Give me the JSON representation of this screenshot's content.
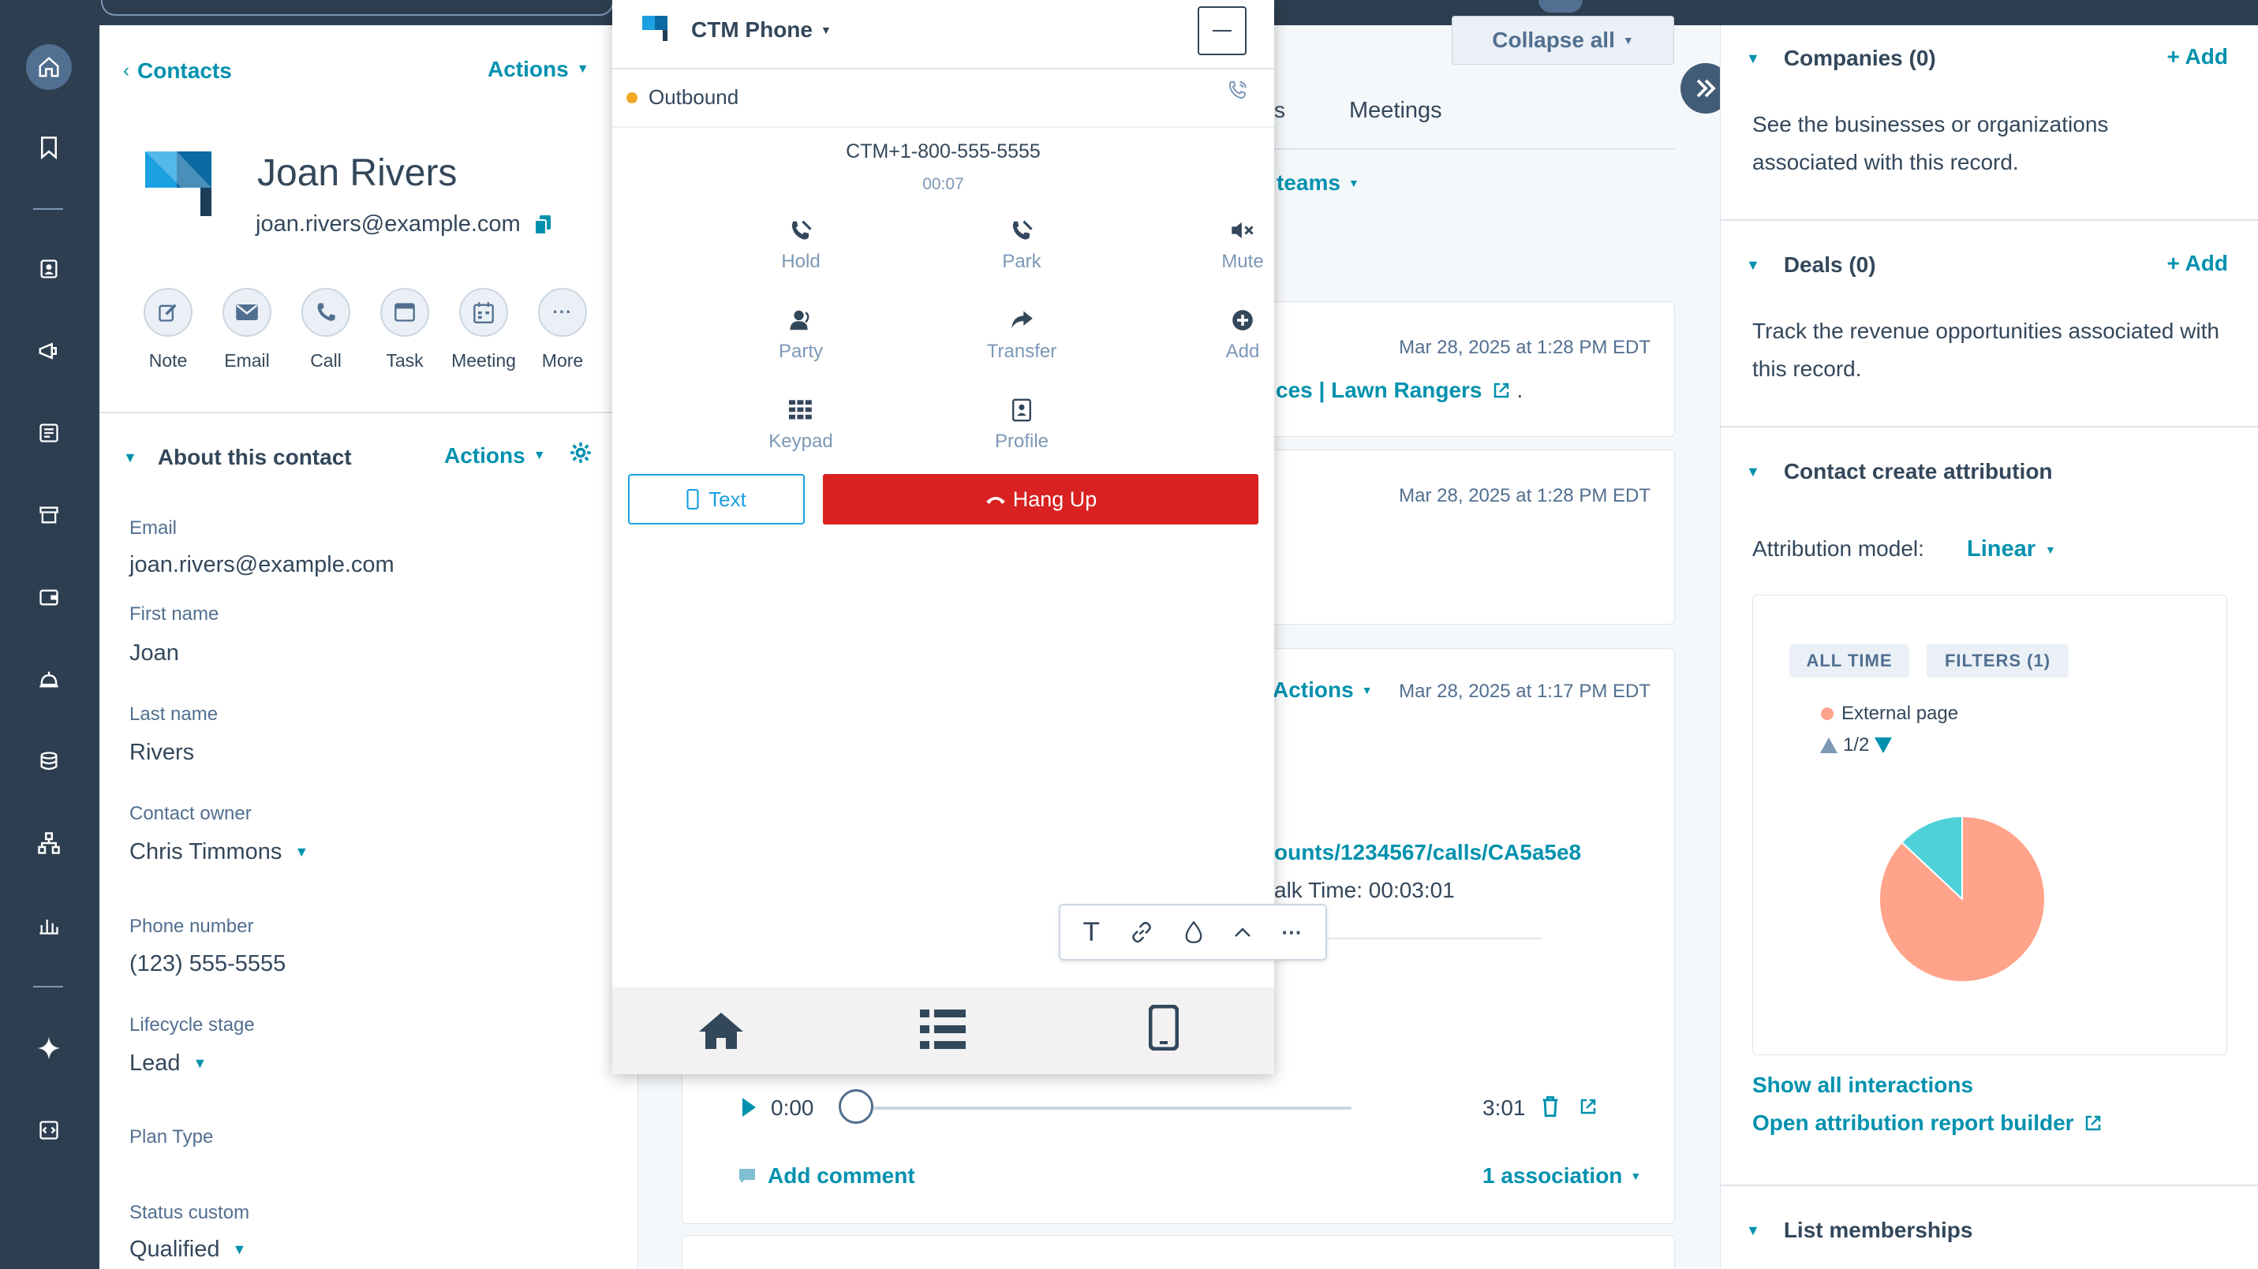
{
  "left": {
    "back_link": "Contacts",
    "header_actions": "Actions",
    "contact_name": "Joan Rivers",
    "contact_email": "joan.rivers@example.com",
    "activity_buttons": [
      "Note",
      "Email",
      "Call",
      "Task",
      "Meeting",
      "More"
    ],
    "about_title": "About this contact",
    "about_actions": "Actions",
    "fields": [
      {
        "label": "Email",
        "value": "joan.rivers@example.com"
      },
      {
        "label": "First name",
        "value": "Joan"
      },
      {
        "label": "Last name",
        "value": "Rivers"
      },
      {
        "label": "Contact owner",
        "value": "Chris Timmons"
      },
      {
        "label": "Phone number",
        "value": "(123) 555-5555"
      },
      {
        "label": "Lifecycle stage",
        "value": "Lead"
      },
      {
        "label": "Plan Type",
        "value": ""
      },
      {
        "label": "Status custom",
        "value": "Qualified"
      }
    ]
  },
  "middle": {
    "collapse_all": "Collapse all",
    "tab_partial": "s",
    "tab_meetings": "Meetings",
    "teams_filter": "teams",
    "card1_ts": "Mar 28, 2025 at 1:28 PM EDT",
    "card1_link": "ces | Lawn Rangers",
    "card1_period": ".",
    "card2_ts": "Mar 28, 2025 at 1:28 PM EDT",
    "card3_actions": "Actions",
    "card3_ts": "Mar 28, 2025 at 1:17 PM EDT",
    "card3_url": "ounts/1234567/calls/CA5a5e8",
    "card3_talk": "alk Time: 00:03:01",
    "audio_start": "0:00",
    "audio_end": "3:01",
    "add_comment": "Add comment",
    "association": "1 association"
  },
  "dialer": {
    "title": "CTM Phone",
    "status": "Outbound",
    "status_color": "#f5a623",
    "number": "CTM+1-800-555-5555",
    "timer": "00:07",
    "controls": [
      "Hold",
      "Park",
      "Mute",
      "Party",
      "Transfer",
      "Add",
      "Keypad",
      "Profile"
    ],
    "text_button": "Text",
    "hangup_button": "Hang Up",
    "hangup_color": "#d92121"
  },
  "right": {
    "companies_title": "Companies (0)",
    "companies_add": "+ Add",
    "companies_desc": "See the businesses or organizations associated with this record.",
    "deals_title": "Deals (0)",
    "deals_add": "+ Add",
    "deals_desc": "Track the revenue opportunities associated with this record.",
    "attribution_title": "Contact create attribution",
    "attribution_model_label": "Attribution model:",
    "attribution_model_value": "Linear",
    "pill_all_time": "ALL TIME",
    "pill_filters": "FILTERS (1)",
    "legend_label": "External page",
    "legend_page": "1/2",
    "show_all": "Show all interactions",
    "open_report": "Open attribution report builder",
    "list_title": "List memberships"
  },
  "chart_data": {
    "type": "pie",
    "title": "",
    "labels": [
      "External page",
      ""
    ],
    "values": [
      87,
      13
    ],
    "colors": [
      "#ffa38a",
      "#4fd1d9"
    ],
    "legend_position": "top-left"
  }
}
